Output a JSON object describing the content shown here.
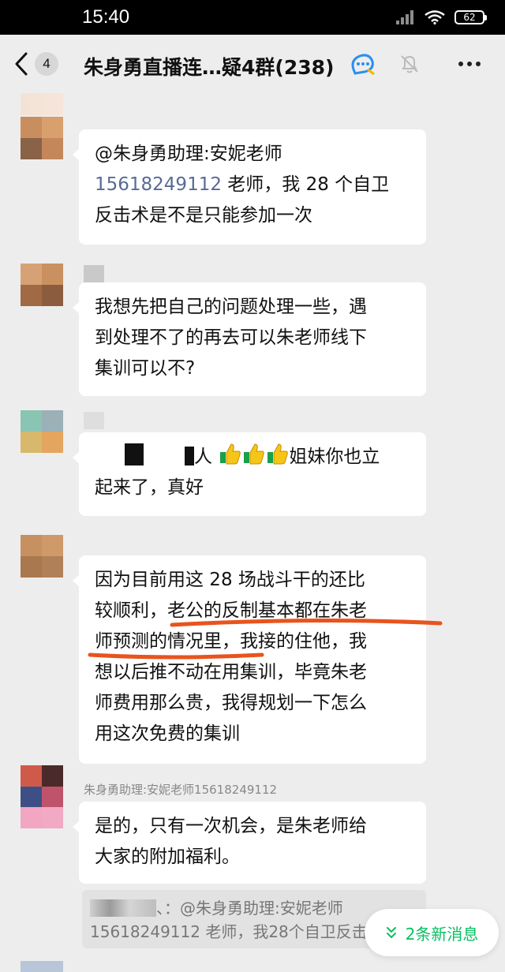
{
  "status_bar": {
    "time": "15:40",
    "battery": "62"
  },
  "header": {
    "back_count": "4",
    "title": "朱身勇直播连…疑4群(238)"
  },
  "messages": [
    {
      "line1": "@朱身勇助理:安妮老师",
      "line2_phone": "15618249112",
      "line2_rest": " 老师，我 28 个自卫",
      "line3": "反击术是不是只能参加一次"
    },
    {
      "line1": "我想先把自己的问题处理一些，遇",
      "line2": "到处理不了的再去可以朱老师线下",
      "line3": "集训可以不?"
    },
    {
      "line1_tail": "人",
      "line1_rest": "姐妹你也立",
      "line2": "起来了，真好"
    },
    {
      "line1": "因为目前用这 28 场战斗干的还比",
      "line2": "较顺利，老公的反制基本都在朱老",
      "line3": "师预测的情况里，我接的住他，我",
      "line4": "想以后推不动在用集训，毕竟朱老",
      "line5": "师费用那么贵，我得规划一下怎么",
      "line6": "用这次免费的集训"
    },
    {
      "sender": "朱身勇助理:安妮老师15618249112",
      "line1": "是的，只有一次机会，是朱老师给",
      "line2": "大家的附加福利。"
    }
  ],
  "quote": {
    "line1": "、：@朱身勇助理:安妮老师",
    "line2": "15618249112 老师，我28个自卫反击"
  },
  "new_messages": {
    "label": "2条新消息"
  },
  "colors": {
    "highlight_underline": "#e8541e",
    "new_msg_green": "#07c160",
    "link_blue": "#576b95"
  },
  "icons": [
    "back-chevron-icon",
    "channel-badge-icon",
    "mute-bell-icon",
    "more-dots-icon",
    "double-chevron-down-icon"
  ]
}
